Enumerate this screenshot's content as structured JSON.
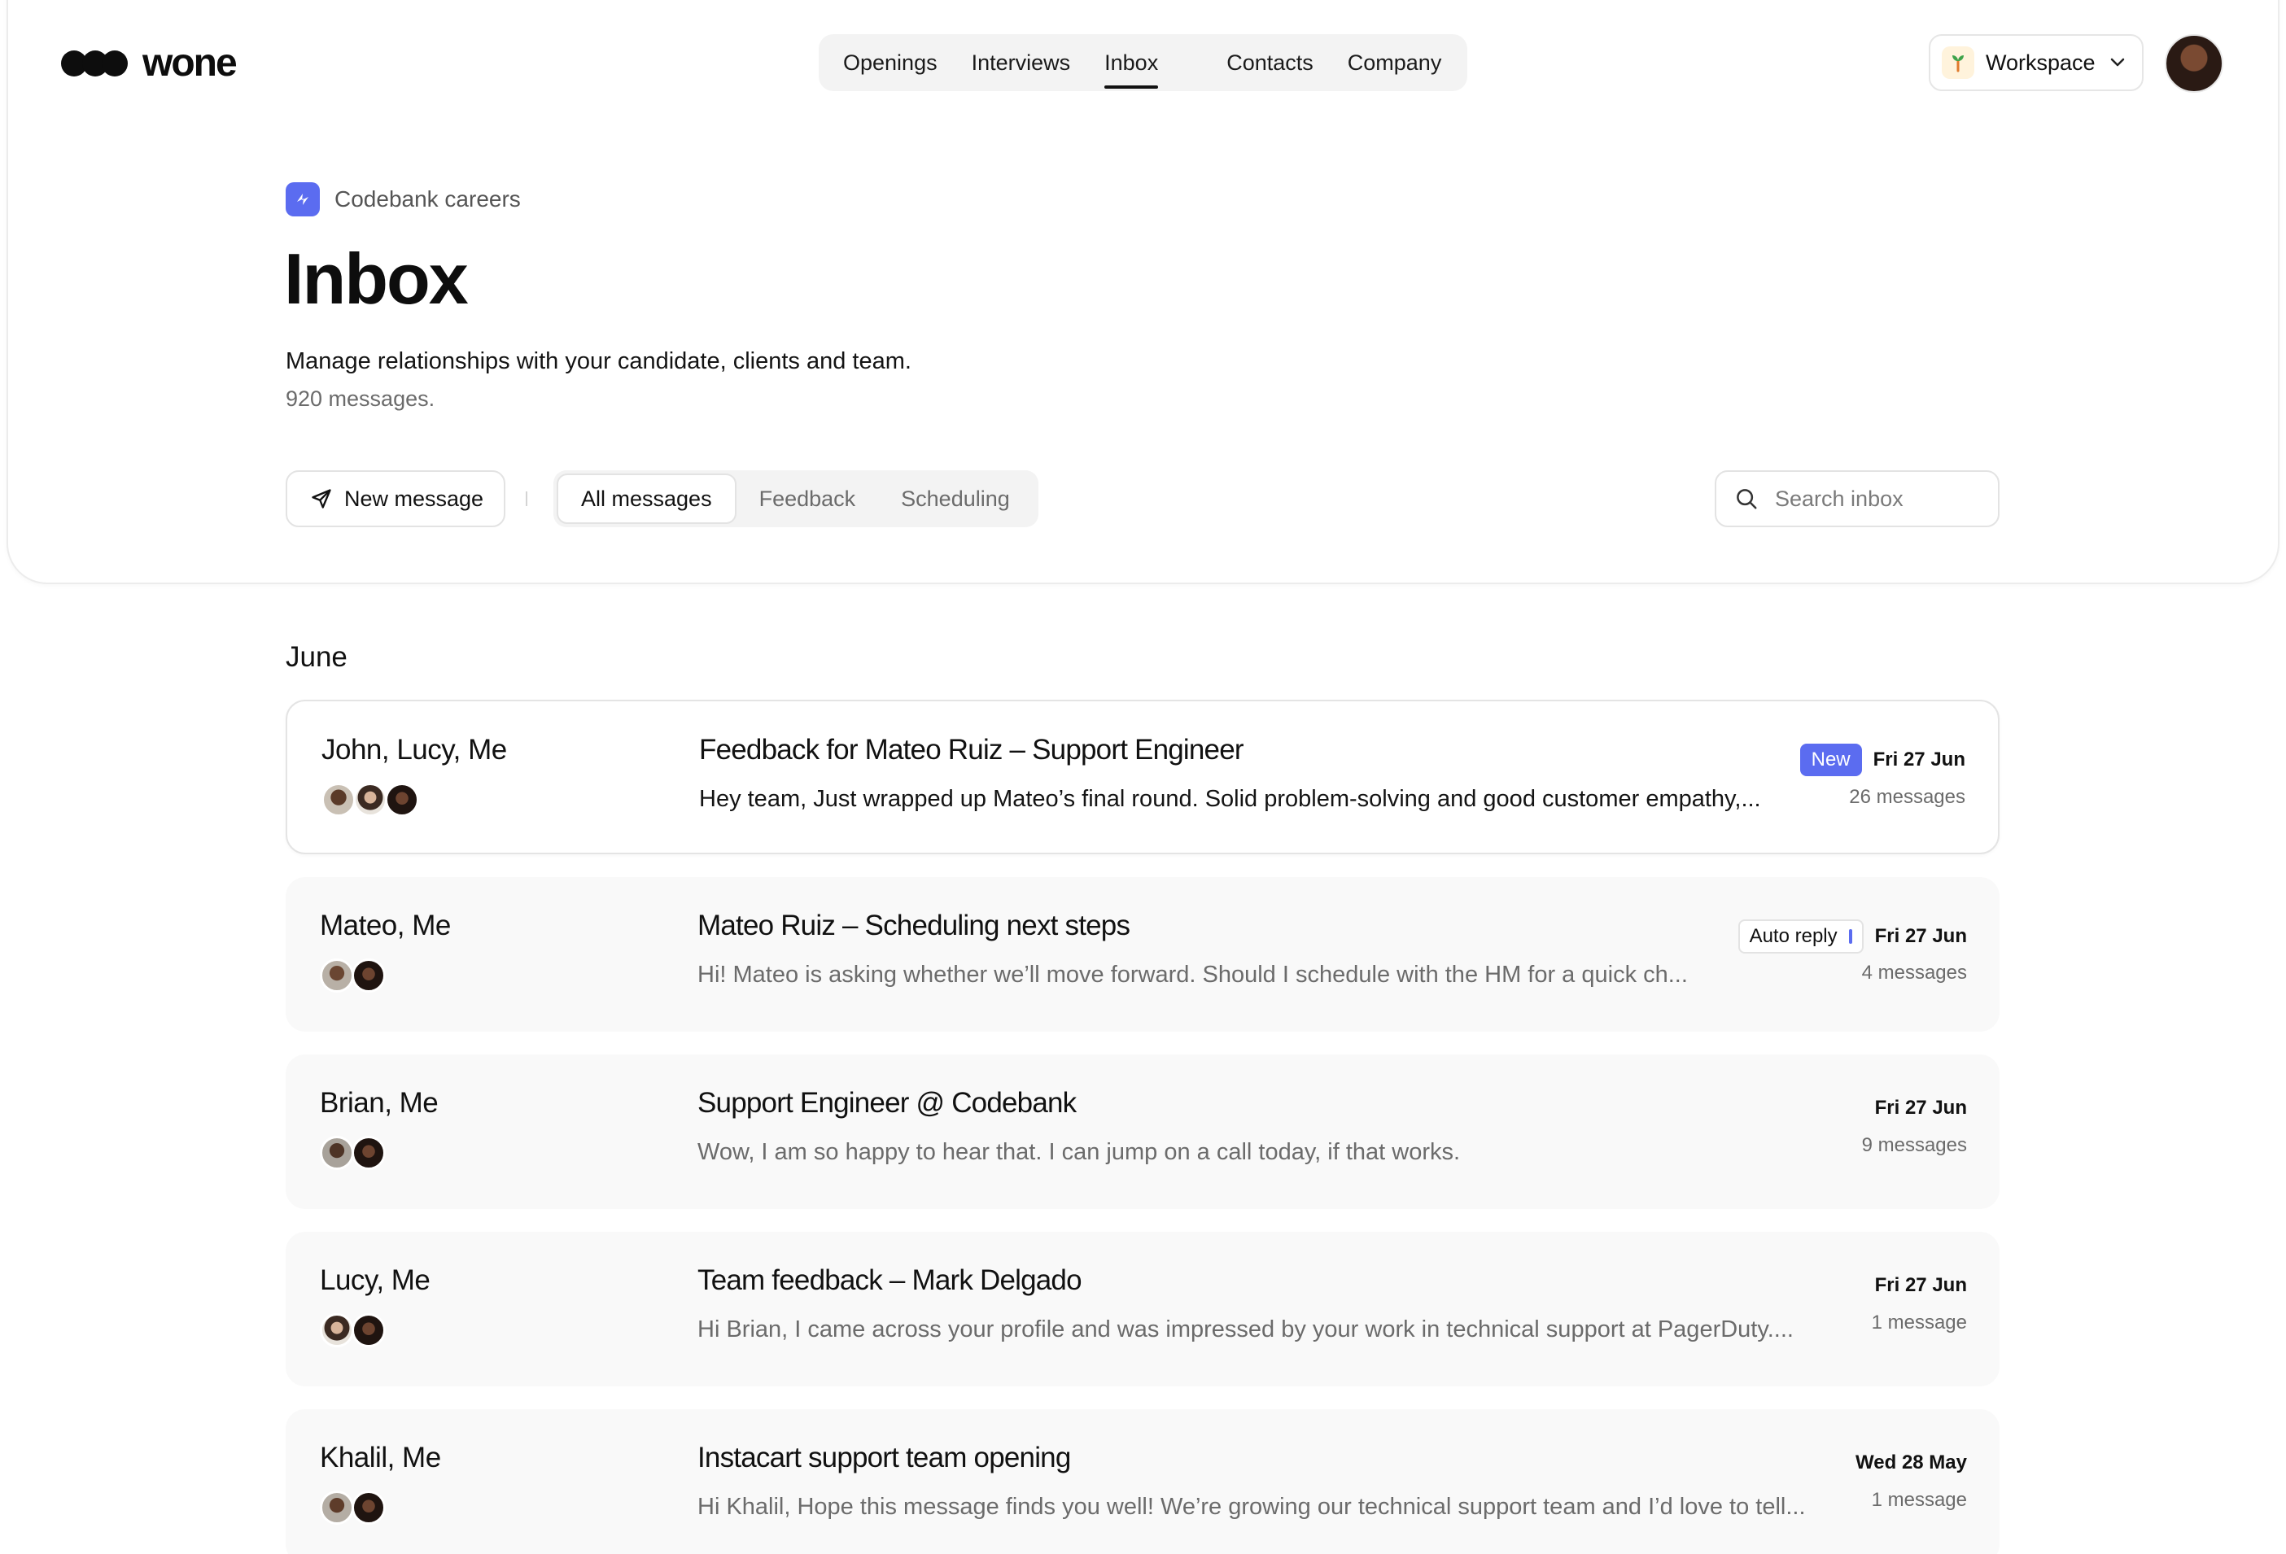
{
  "app": {
    "logo_text": "wone"
  },
  "nav": {
    "items": [
      {
        "label": "Openings"
      },
      {
        "label": "Interviews"
      },
      {
        "label": "Inbox",
        "active": true
      },
      {
        "label": "Contacts"
      },
      {
        "label": "Company"
      }
    ]
  },
  "workspace": {
    "label": "Workspace"
  },
  "header": {
    "brand": "Codebank careers",
    "title": "Inbox",
    "subtitle": "Manage relationships with your candidate, clients and team.",
    "message_count": "920 messages."
  },
  "toolbar": {
    "new_message_label": "New message",
    "filters": [
      {
        "label": "All messages",
        "active": true
      },
      {
        "label": "Feedback"
      },
      {
        "label": "Scheduling"
      }
    ],
    "search_placeholder": "Search inbox"
  },
  "list": {
    "month": "June",
    "threads": [
      {
        "participants": "John, Lucy, Me",
        "subject": "Feedback for Mateo Ruiz – Support Engineer",
        "preview": "Hey team, Just wrapped up Mateo’s final round. Solid problem-solving and good customer empathy,...",
        "badge": "New",
        "date": "Fri 27 Jun",
        "count": "26 messages"
      },
      {
        "participants": "Mateo, Me",
        "subject": "Mateo Ruiz – Scheduling next steps",
        "preview": "Hi! Mateo is asking whether we’ll move forward. Should I schedule with the HM for a quick ch...",
        "badge": "Auto reply",
        "date": "Fri 27 Jun",
        "count": "4 messages"
      },
      {
        "participants": "Brian, Me",
        "subject": "Support Engineer @ Codebank",
        "preview": "Wow, I am so happy to hear that. I can jump on a call today, if that works.",
        "date": "Fri 27 Jun",
        "count": "9 messages"
      },
      {
        "participants": "Lucy, Me",
        "subject": "Team feedback – Mark Delgado",
        "preview": "Hi Brian, I came across your profile and was impressed by your work in technical support at PagerDuty....",
        "date": "Fri 27 Jun",
        "count": "1 message"
      },
      {
        "participants": "Khalil, Me",
        "subject": "Instacart support team opening",
        "preview": "Hi Khalil, Hope this message finds you well! We’re growing our technical support team and I’d love to tell...",
        "date": "Wed 28 May",
        "count": "1 message"
      }
    ]
  },
  "colors": {
    "accent": "#5b6cf0",
    "text": "#111111",
    "muted": "#6b6b6b",
    "row_bg": "#f9f9f9"
  }
}
